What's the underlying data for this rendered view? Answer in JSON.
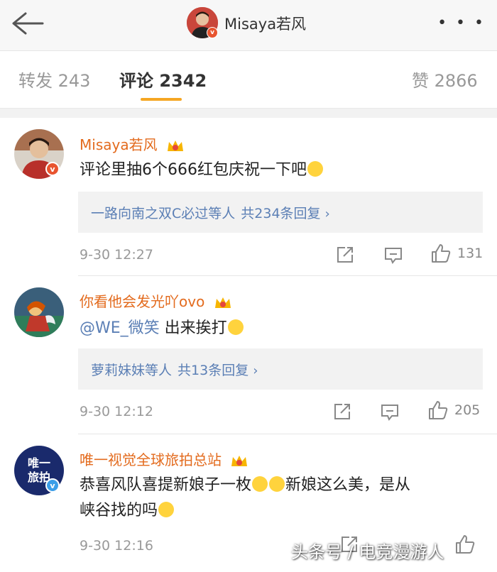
{
  "header": {
    "title": "Misaya若风",
    "more_label": "• • •"
  },
  "tabs": [
    {
      "label": "转发 243"
    },
    {
      "label": "评论 2342"
    },
    {
      "label": "赞 2866"
    }
  ],
  "colors": {
    "accent": "#f5a623",
    "username": "#e36b1e",
    "link": "#5b7fb5",
    "meta": "#999999",
    "verified_badge": "#e8542f"
  },
  "comments": [
    {
      "username": "Misaya若风",
      "text": "评论里抽6个666红包庆祝一下吧",
      "reply_names": "一路向南之双C必过等人",
      "reply_count": "共234条回复",
      "time": "9-30 12:27",
      "likes": "131"
    },
    {
      "username": "你看他会发光吖ovo",
      "mention": "@WE_微笑",
      "text": " 出来挨打",
      "reply_names": "萝莉妹妹等人",
      "reply_count": "共13条回复",
      "time": "9-30 12:12",
      "likes": "205"
    },
    {
      "username": "唯一视觉全球旅拍总站",
      "avatar_text": "唯一\n旅拍",
      "text_part1": "恭喜风队喜提新娘子一枚",
      "text_part2": "新娘这么美，是从",
      "text_line2": "峡谷找的吗",
      "time": "9-30 12:16"
    }
  ],
  "watermark": "头条号 / 电竞漫游人"
}
